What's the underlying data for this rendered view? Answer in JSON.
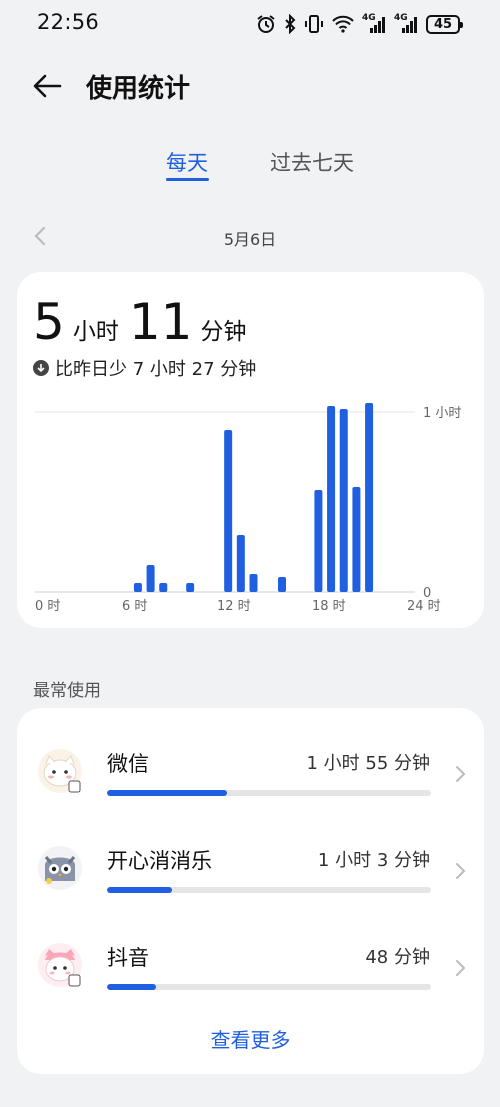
{
  "status_bar": {
    "time": "22:56",
    "net1": "4G",
    "net2": "4G",
    "battery": "45",
    "icons": [
      "alarm-icon",
      "bluetooth-icon",
      "vibrate-icon",
      "wifi-icon",
      "signal-icon",
      "signal-icon",
      "battery-icon"
    ]
  },
  "header": {
    "title": "使用统计",
    "back_icon": "back-arrow-icon"
  },
  "tabs": [
    {
      "label": "每天",
      "active": true
    },
    {
      "label": "过去七天",
      "active": false
    }
  ],
  "date": {
    "label": "5月6日",
    "prev_icon": "chevron-left-icon"
  },
  "usage": {
    "hours": "5",
    "hours_unit": "小时",
    "minutes": "11",
    "minutes_unit": "分钟",
    "compare": "比昨日少 7 小时 27 分钟",
    "compare_icon": "arrow-down-circle-icon"
  },
  "chart_data": {
    "type": "bar",
    "x_ticks": [
      "0 时",
      "6 时",
      "12 时",
      "18 时",
      "24 时"
    ],
    "y_ticks": [
      "1 小时",
      "0"
    ],
    "ylim": [
      0,
      60
    ],
    "xlim": [
      0,
      24
    ],
    "unit": "minutes",
    "bars": [
      {
        "hour": 6.5,
        "value": 3
      },
      {
        "hour": 7.3,
        "value": 9
      },
      {
        "hour": 8.1,
        "value": 3
      },
      {
        "hour": 9.8,
        "value": 3
      },
      {
        "hour": 12.2,
        "value": 54
      },
      {
        "hour": 13.0,
        "value": 19
      },
      {
        "hour": 13.8,
        "value": 6
      },
      {
        "hour": 15.6,
        "value": 5
      },
      {
        "hour": 17.9,
        "value": 34
      },
      {
        "hour": 18.7,
        "value": 62
      },
      {
        "hour": 19.5,
        "value": 61
      },
      {
        "hour": 20.3,
        "value": 35
      },
      {
        "hour": 21.1,
        "value": 63
      }
    ],
    "grid": true,
    "bar_color": "#1f5fe0"
  },
  "section_label": "最常使用",
  "apps": [
    {
      "name": "微信",
      "time": "1 小时 55 分钟",
      "progress": 0.37,
      "icon": "cat-avatar-icon"
    },
    {
      "name": "开心消消乐",
      "time": "1 小时 3 分钟",
      "progress": 0.2,
      "icon": "owl-avatar-icon"
    },
    {
      "name": "抖音",
      "time": "48 分钟",
      "progress": 0.15,
      "icon": "pink-cat-avatar-icon"
    }
  ],
  "view_more": "查看更多",
  "colors": {
    "accent": "#1f5fe0",
    "background": "#f1f2f4",
    "card": "#ffffff"
  }
}
